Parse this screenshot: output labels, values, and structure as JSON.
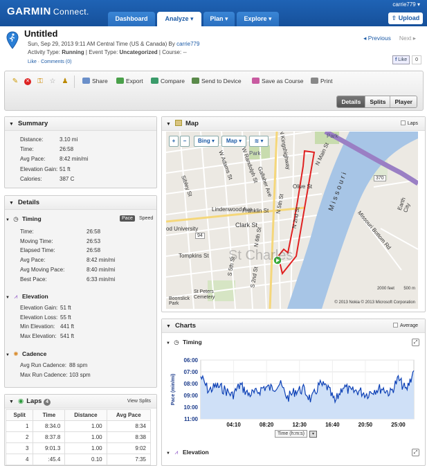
{
  "brand": {
    "name": "GARMIN",
    "product": "Connect."
  },
  "nav": {
    "dashboard": "Dashboard",
    "analyze": "Analyze",
    "plan": "Plan",
    "explore": "Explore"
  },
  "user": {
    "name": "carrie779",
    "upload": "Upload"
  },
  "activity": {
    "title": "Untitled",
    "datetime": "Sun, Sep 29, 2013 9:11 AM Central Time (US & Canada) By",
    "author": "carrie779",
    "type_label": "Activity Type:",
    "type": "Running",
    "event_label": "Event Type:",
    "event": "Uncategorized",
    "course_label": "Course:",
    "course": "--",
    "like": "Like",
    "comments": "Comments (0)"
  },
  "pager": {
    "previous": "Previous",
    "next": "Next"
  },
  "facebook": {
    "like": "Like",
    "count": "0"
  },
  "toolbar": {
    "share": "Share",
    "export": "Export",
    "compare": "Compare",
    "send": "Send to Device",
    "save_course": "Save as Course",
    "print": "Print"
  },
  "view_tabs": [
    "Details",
    "Splits",
    "Player"
  ],
  "summary": {
    "title": "Summary",
    "rows": [
      {
        "label": "Distance:",
        "value": "3.10 mi"
      },
      {
        "label": "Time:",
        "value": "26:58"
      },
      {
        "label": "Avg Pace:",
        "value": "8:42 min/mi"
      },
      {
        "label": "Elevation Gain:",
        "value": "51 ft"
      },
      {
        "label": "Calories:",
        "value": "387 C"
      }
    ]
  },
  "details": {
    "title": "Details",
    "timing": {
      "title": "Timing",
      "pace": "Pace",
      "speed": "Speed",
      "rows": [
        {
          "label": "Time:",
          "value": "26:58"
        },
        {
          "label": "Moving Time:",
          "value": "26:53"
        },
        {
          "label": "Elapsed Time:",
          "value": "26:58"
        },
        {
          "label": "Avg Pace:",
          "value": "8:42 min/mi"
        },
        {
          "label": "Avg Moving Pace:",
          "value": "8:40 min/mi"
        },
        {
          "label": "Best Pace:",
          "value": "6:33 min/mi"
        }
      ]
    },
    "elevation": {
      "title": "Elevation",
      "rows": [
        {
          "label": "Elevation Gain:",
          "value": "51 ft"
        },
        {
          "label": "Elevation Loss:",
          "value": "55 ft"
        },
        {
          "label": "Min Elevation:",
          "value": "441 ft"
        },
        {
          "label": "Max Elevation:",
          "value": "541 ft"
        }
      ]
    },
    "cadence": {
      "title": "Cadence",
      "rows": [
        {
          "label": "Avg Run Cadence:",
          "value": "88 spm"
        },
        {
          "label": "Max Run Cadence:",
          "value": "103 spm"
        }
      ]
    }
  },
  "laps": {
    "title": "Laps",
    "count": "4",
    "view_splits": "View Splits",
    "headers": [
      "Split",
      "Time",
      "Distance",
      "Avg Pace"
    ],
    "rows": [
      [
        "1",
        "8:34.0",
        "1.00",
        "8:34"
      ],
      [
        "2",
        "8:37.8",
        "1.00",
        "8:38"
      ],
      [
        "3",
        "9:01.3",
        "1.00",
        "9:02"
      ],
      [
        "4",
        ":45.4",
        "0.10",
        "7:35"
      ]
    ]
  },
  "map": {
    "title": "Map",
    "laps": "Laps",
    "bing": "Bing",
    "maptype": "Map",
    "watermark": "St Charles",
    "scale_ft": "2000 feet",
    "scale_m": "500 m",
    "copyright": "© 2013 Nokia   © 2013 Microsoft Corporation",
    "labels": {
      "park1": "Park",
      "park2": "Park",
      "olive": "Olive St",
      "n_main": "N Main St",
      "missouri": "Missouri",
      "route370": "370",
      "n_5th": "N 5th St",
      "n_2nd": "N 2nd St",
      "franklin": "Franklin St",
      "lindenwood": "Lindenwood Ave",
      "clark": "Clark St",
      "university": "od University",
      "route94": "94",
      "tompkins": "Tompkins St",
      "cemetery1": "St Peters",
      "cemetery2": "Cemetery",
      "boonslick1": "Boonslick",
      "boonslick2": "Park",
      "missouri_bottom": "Missouri Bottom Rd",
      "earth_city": "Earth City",
      "w_adams": "W Adams St",
      "w_randolph": "W Randolph St",
      "gallaher": "Gallaher Ave",
      "sibley": "Sibley St",
      "n_6th": "N 6th St",
      "s_5th": "S 5th St",
      "s_2nd": "S 2nd St",
      "n_kings": "N Kingshighway"
    }
  },
  "charts": {
    "title": "Charts",
    "average": "Average",
    "timing_title": "Timing",
    "elevation_title": "Elevation",
    "xaxis_label": "Time (h:m:s)"
  },
  "chart_data": {
    "type": "area",
    "ylabel": "Pace (min/mi)",
    "xlabel": "Time (h:m:s)",
    "y_reversed": true,
    "ylim": [
      6.0,
      11.0
    ],
    "yticks": [
      "06:00",
      "07:00",
      "08:00",
      "09:00",
      "10:00",
      "11:00"
    ],
    "xlim": [
      "00:00",
      "26:58"
    ],
    "xticks": [
      "04:10",
      "08:20",
      "12:30",
      "16:40",
      "20:50",
      "25:00"
    ],
    "x_min": [
      0,
      1,
      2,
      3,
      4,
      5,
      6,
      7,
      8,
      9,
      10,
      11,
      12,
      13,
      14,
      15,
      16,
      17,
      18,
      19,
      20,
      21,
      22,
      23,
      24,
      25,
      26,
      26.97
    ],
    "pace_min": [
      7.4,
      8.6,
      8.2,
      8.5,
      9.0,
      8.1,
      8.9,
      8.8,
      8.3,
      8.4,
      8.0,
      9.2,
      8.6,
      8.5,
      9.4,
      8.1,
      8.3,
      9.6,
      8.2,
      8.7,
      8.6,
      8.9,
      8.5,
      8.4,
      8.8,
      7.6,
      8.6,
      6.9
    ],
    "color": "#0b3fb5"
  }
}
